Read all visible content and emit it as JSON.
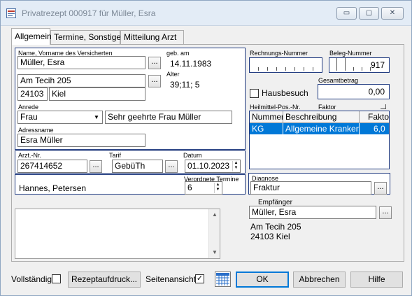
{
  "window": {
    "title": "Privatrezept 000917 für Müller, Esra",
    "minimize": "▭",
    "maximize": "▢",
    "close": "✕"
  },
  "tabs": [
    {
      "label": "Allgemein",
      "active": true
    },
    {
      "label": "Termine, Sonstiges",
      "active": false
    },
    {
      "label": "Mitteilung Arzt",
      "active": false
    }
  ],
  "patient": {
    "name_label": "Name, Vorname des Versicherten",
    "name": "Müller, Esra",
    "street": "Am Tecih 205",
    "zip": "24103",
    "city": "Kiel",
    "birth_label": "geb. am",
    "birth": "14.11.1983",
    "age_label": "Alter",
    "age": "39;11; 5",
    "salutation_label": "Anrede",
    "salutation": "Frau",
    "greeting": "Sehr geehrte Frau Müller",
    "address_name_label": "Adressname",
    "address_name": "Esra Müller"
  },
  "doctor": {
    "arzt_nr_label": "Arzt.-Nr.",
    "arzt_nr": "267414652",
    "tarif_label": "Tarif",
    "tarif": "GebüTh",
    "datum_label": "Datum",
    "datum": "01.10.2023",
    "name": "Hannes, Petersen",
    "termine_label": "Verordnete Termine",
    "termine": "6"
  },
  "billing": {
    "rechnungs_label": "Rechnungs-Nummer",
    "beleg_label": "Beleg-Nummer",
    "beleg": "917",
    "hausbesuch_label": "Hausbesuch",
    "gesamt_label": "Gesamtbetrag",
    "gesamt": "0,00"
  },
  "heilmittel": {
    "label": "Heilmittel-Pos.-Nr.",
    "faktor_label": "Faktor",
    "columns": [
      "Nummer",
      "Beschreibung",
      "Faktor"
    ],
    "rows": [
      {
        "nummer": "KG",
        "beschreibung": "Allgemeine Krankengy",
        "faktor": "6,0"
      }
    ]
  },
  "diagnose": {
    "label": "Diagnose",
    "value": "Fraktur"
  },
  "empfaenger": {
    "label": "Empfänger",
    "name": "Müller, Esra",
    "street": "Am Tecih 205",
    "zip_city": "24103  Kiel"
  },
  "footer": {
    "vollstaendig": "Vollständig",
    "rezeptaufdruck": "Rezeptaufdruck...",
    "seitenansicht": "Seitenansicht",
    "seitenansicht_checked": "✓",
    "ok": "OK",
    "abbrechen": "Abbrechen",
    "hilfe": "Hilfe"
  },
  "icons": {
    "dots": "...",
    "combo": "▼",
    "spin_up": "▲",
    "spin_down": "▼",
    "scroll_up": "▲",
    "scroll_down": "▼"
  },
  "colors": {
    "accent": "#0078d7",
    "group_border": "#1f3a80"
  }
}
